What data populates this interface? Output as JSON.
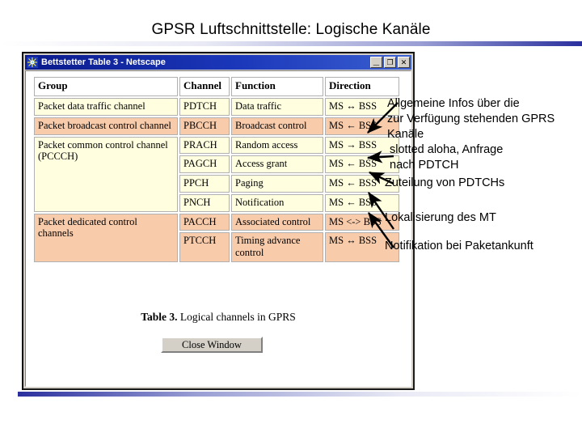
{
  "slide": {
    "title": "GPSR Luftschnittstelle: Logische Kanäle"
  },
  "window": {
    "title": "Bettstetter Table 3 - Netscape",
    "icon": "netscape-star-icon",
    "minimize_label": "_",
    "maximize_label": "❐",
    "close_label": "✕"
  },
  "table": {
    "headers": [
      "Group",
      "Channel",
      "Function",
      "Direction"
    ],
    "rows": [
      {
        "group": "Packet data traffic channel",
        "group_rowspan": 1,
        "color": "cream",
        "channel": "PDTCH",
        "function": "Data traffic",
        "direction": "MS ↔ BSS"
      },
      {
        "group": "Packet broadcast control channel",
        "group_rowspan": 1,
        "color": "peach",
        "channel": "PBCCH",
        "function": "Broadcast control",
        "direction": "MS ← BSS"
      },
      {
        "group": "Packet common control channel (PCCCH)",
        "group_rowspan": 4,
        "color": "cream",
        "channel": "PRACH",
        "function": "Random access",
        "direction": "MS → BSS"
      },
      {
        "group": null,
        "color": "cream",
        "channel": "PAGCH",
        "function": "Access grant",
        "direction": "MS ← BSS"
      },
      {
        "group": null,
        "color": "cream",
        "channel": "PPCH",
        "function": "Paging",
        "direction": "MS ← BSS"
      },
      {
        "group": null,
        "color": "cream",
        "channel": "PNCH",
        "function": "Notification",
        "direction": "MS ← BSS"
      },
      {
        "group": "Packet dedicated control channels",
        "group_rowspan": 2,
        "color": "peach",
        "channel": "PACCH",
        "function": "Associated control",
        "direction": "MS <-> BSS"
      },
      {
        "group": null,
        "color": "peach",
        "channel": "PTCCH",
        "function": "Timing advance control",
        "direction": "MS ↔ BSS"
      }
    ],
    "caption_strong": "Table 3.",
    "caption_rest": " Logical channels in GPRS",
    "colors": {
      "cream": "#FFFFE0",
      "peach": "#F8CBAB",
      "header": "#FFFFFF",
      "border": "#B0B0B0"
    }
  },
  "buttons": {
    "close_window": "Close Window"
  },
  "annotations": [
    {
      "id": "general",
      "text": "Allgemeine Infos über die\nzur Verfügung stehenden GPRS\nKanäle"
    },
    {
      "id": "slotted",
      "text": "slotted aloha, Anfrage\nnach PDTCH"
    },
    {
      "id": "zuteilung",
      "text": "Zuteilung von PDTCHs"
    },
    {
      "id": "lokalisierung",
      "text": "Lokalisierung des MT"
    },
    {
      "id": "notifikation",
      "text": "Notifikation bei Paketankunft"
    }
  ],
  "theme": {
    "title_bar_blue": "#0A1A8C",
    "rule_blue": "#2A2F9E",
    "window_face": "#D4D0C8"
  }
}
